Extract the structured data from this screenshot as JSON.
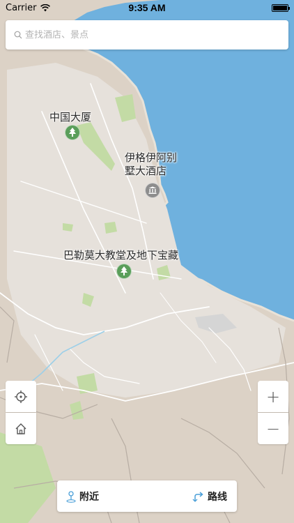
{
  "status_bar": {
    "carrier": "Carrier",
    "time": "9:35 AM",
    "battery_level": 1.0
  },
  "search": {
    "placeholder": "查找酒店、景点",
    "icon": "search-icon"
  },
  "map": {
    "water_color": "#6fb1de",
    "land_color": "#dcd2c6",
    "park_color": "#c3dba5",
    "road_color": "#ffffff"
  },
  "pois": [
    {
      "label": "中国大厦",
      "icon": "tree-icon",
      "color": "#5a9e5a"
    },
    {
      "label": "伊格伊阿别\n墅大酒店",
      "icon": "museum-icon",
      "color": "#8d8d8d"
    },
    {
      "label": "巴勒莫大教堂及地下宝藏",
      "icon": "tree-icon",
      "color": "#5a9e5a"
    }
  ],
  "controls": {
    "locate_icon": "crosshair-icon",
    "home_icon": "home-icon",
    "zoom_in": "+",
    "zoom_out": "−"
  },
  "bottom_bar": {
    "nearby_label": "附近",
    "nearby_icon": "person-pin-icon",
    "route_label": "路线",
    "route_icon": "route-arrow-icon"
  }
}
